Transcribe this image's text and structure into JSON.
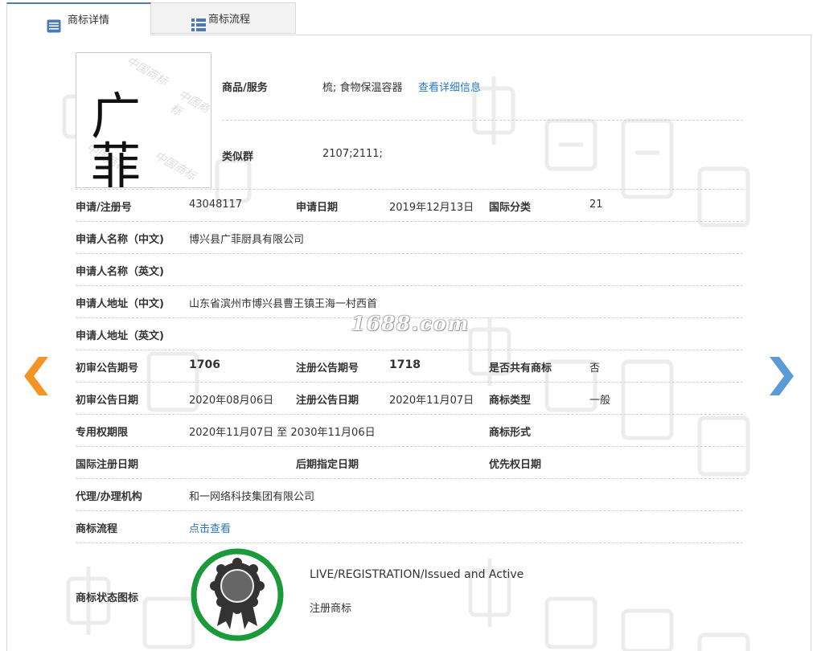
{
  "tabs": [
    {
      "label": "商标详情",
      "icon": "list-doc-icon",
      "active": true
    },
    {
      "label": "商标流程",
      "icon": "list-icon",
      "active": false
    }
  ],
  "logo": {
    "text": "广 菲",
    "watermark": "中国商标"
  },
  "goods": {
    "label": "商品/服务",
    "value": "梳; 食物保温容器",
    "link": "查看详细信息"
  },
  "similar_group": {
    "label": "类似群",
    "value": "2107;2111;"
  },
  "reg_no": {
    "label": "申请/注册号",
    "value": "43048117"
  },
  "apply_date": {
    "label": "申请日期",
    "value": "2019年12月13日"
  },
  "intl_class": {
    "label": "国际分类",
    "value": "21"
  },
  "applicant_cn": {
    "label": "申请人名称（中文)",
    "value": "博兴县广菲厨具有限公司"
  },
  "applicant_en": {
    "label": "申请人名称（英文)",
    "value": ""
  },
  "address_cn": {
    "label": "申请人地址（中文)",
    "value": "山东省滨州市博兴县曹王镇王海一村西首"
  },
  "address_en": {
    "label": "申请人地址（英文)",
    "value": ""
  },
  "prelim_issue": {
    "label": "初审公告期号",
    "value": "1706"
  },
  "reg_issue": {
    "label": "注册公告期号",
    "value": "1718"
  },
  "shared": {
    "label": "是否共有商标",
    "value": "否"
  },
  "prelim_date": {
    "label": "初审公告日期",
    "value": "2020年08月06日"
  },
  "reg_date": {
    "label": "注册公告日期",
    "value": "2020年11月07日"
  },
  "tm_type": {
    "label": "商标类型",
    "value": "一般"
  },
  "exclusive": {
    "label": "专用权期限",
    "value": "2020年11月07日 至 2030年11月06日"
  },
  "tm_form": {
    "label": "商标形式",
    "value": ""
  },
  "intl_reg_date": {
    "label": "国际注册日期",
    "value": ""
  },
  "later_date": {
    "label": "后期指定日期",
    "value": ""
  },
  "priority_date": {
    "label": "优先权日期",
    "value": ""
  },
  "agent": {
    "label": "代理/办理机构",
    "value": "和一网络科技集团有限公司"
  },
  "flow": {
    "label": "商标流程",
    "link": "点击查看"
  },
  "status": {
    "label": "商标状态图标",
    "en": "LIVE/REGISTRATION/Issued and Active",
    "cn": "注册商标"
  },
  "watermark_site": "1688.com",
  "colors": {
    "accent": "#4a78b8",
    "link": "#2a79c5",
    "arrow_left": "#f39423",
    "arrow_right": "#5b9bd5",
    "seal_ring": "#1a9a3a"
  }
}
